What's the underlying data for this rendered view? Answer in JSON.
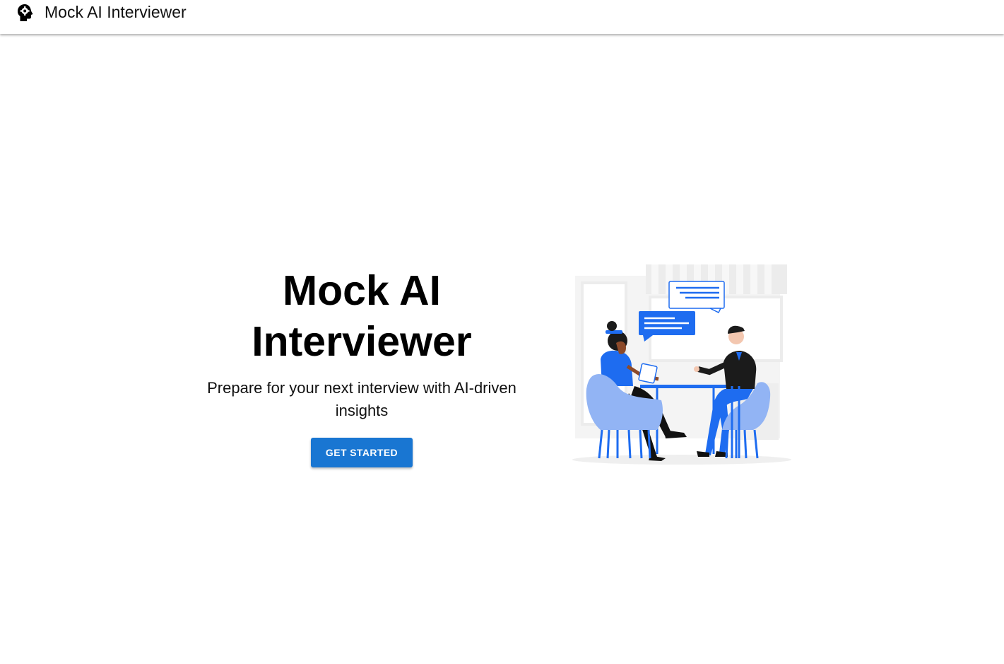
{
  "appbar": {
    "title": "Mock AI Interviewer",
    "icon": "psychology-head-icon"
  },
  "hero": {
    "title": "Mock AI Interviewer",
    "subtitle": "Prepare for your next interview with AI-driven insights",
    "cta_label": "GET STARTED",
    "illustration": "interview-illustration"
  },
  "colors": {
    "primary": "#1976d2",
    "illustration_blue": "#1e6cf0",
    "chair_light_blue": "#92b4f4",
    "text": "#000000"
  }
}
